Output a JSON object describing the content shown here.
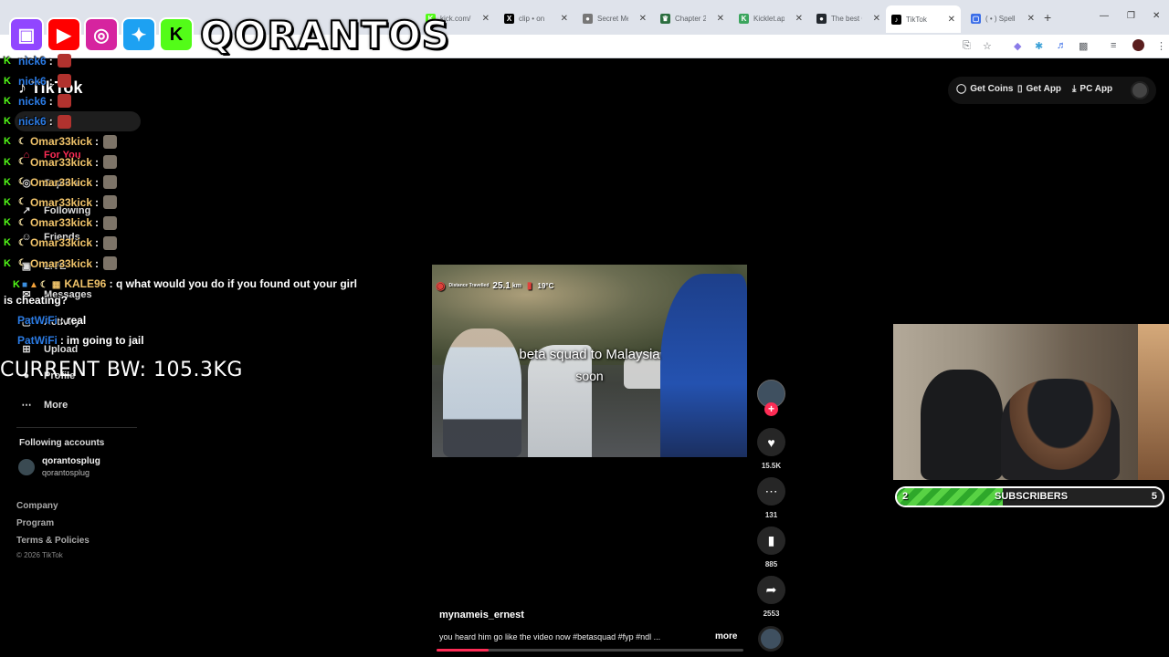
{
  "browser": {
    "tabs": [
      {
        "title": "kick.com/",
        "favicon": "kick-icon",
        "color": "#53fc18",
        "glyph": "K"
      },
      {
        "title": "clip • on",
        "favicon": "x-icon",
        "color": "#000000",
        "glyph": "X"
      },
      {
        "title": "Secret Me",
        "favicon": "gray-circle-icon",
        "color": "#777777",
        "glyph": "●"
      },
      {
        "title": "Chapter 2",
        "favicon": "crown-icon",
        "color": "#2c6e3f",
        "glyph": "♛"
      },
      {
        "title": "Kicklet.app",
        "favicon": "kicklet-icon",
        "color": "#3ba55d",
        "glyph": "K"
      },
      {
        "title": "The best C",
        "favicon": "github-icon",
        "color": "#24292f",
        "glyph": "●"
      },
      {
        "title": "TikTok",
        "favicon": "tiktok-icon",
        "color": "#000000",
        "glyph": "♪"
      },
      {
        "title": "( • ) Spell",
        "favicon": "spell-icon",
        "color": "#3b6ee8",
        "glyph": "▢"
      }
    ]
  },
  "overlay": {
    "brand": "QORANTOS",
    "socials": [
      {
        "name": "twitch-icon",
        "color": "#9146ff",
        "glyph": "▣"
      },
      {
        "name": "youtube-icon",
        "color": "#ff0000",
        "glyph": "▶"
      },
      {
        "name": "instagram-icon",
        "color": "#d6249f",
        "glyph": "◎"
      },
      {
        "name": "twitter-icon",
        "color": "#1da1f2",
        "glyph": "✦"
      },
      {
        "name": "kick-icon",
        "color": "#53fc18",
        "glyph": "K"
      }
    ],
    "bodyweight": "CURRENT BW: 105.3KG",
    "subscribers": {
      "label": "SUBSCRIBERS",
      "current": "2",
      "goal": "5",
      "progress": 0.4
    }
  },
  "chat": {
    "lines": [
      {
        "user": "nick6",
        "color": "#2b7be4",
        "badge": "K",
        "moon": false,
        "emote": "red"
      },
      {
        "user": "nick6",
        "color": "#2b7be4",
        "badge": "K",
        "moon": false,
        "emote": "red"
      },
      {
        "user": "nick6",
        "color": "#2b7be4",
        "badge": "K",
        "moon": false,
        "emote": "red"
      },
      {
        "user": "nick6",
        "color": "#2b7be4",
        "badge": "K",
        "moon": false,
        "emote": "red"
      },
      {
        "user": "Omar33kick",
        "color": "#f0c36a",
        "badge": "K",
        "moon": true,
        "emote": "gray"
      },
      {
        "user": "Omar33kick",
        "color": "#f0c36a",
        "badge": "K",
        "moon": true,
        "emote": "gray"
      },
      {
        "user": "Omar33kick",
        "color": "#f0c36a",
        "badge": "K",
        "moon": true,
        "emote": "gray"
      },
      {
        "user": "Omar33kick",
        "color": "#f0c36a",
        "badge": "K",
        "moon": true,
        "emote": "gray"
      },
      {
        "user": "Omar33kick",
        "color": "#f0c36a",
        "badge": "K",
        "moon": true,
        "emote": "gray"
      },
      {
        "user": "Omar33kick",
        "color": "#f0c36a",
        "badge": "K",
        "moon": true,
        "emote": "gray"
      },
      {
        "user": "Omar33kick",
        "color": "#f0c36a",
        "badge": "K",
        "moon": true,
        "emote": "gray"
      }
    ],
    "kale": {
      "user": "KALE96",
      "color": "#f0c36a",
      "message": "q what would you do if you found out your girl is cheating?"
    },
    "patwifi": [
      {
        "user": "PatWiFi",
        "color": "#2b7be4",
        "message": "real"
      },
      {
        "user": "PatWiFi",
        "color": "#2b7be4",
        "message": "im going to jail"
      }
    ]
  },
  "tiktok": {
    "logo": "TikTok",
    "header": {
      "coins": "Get Coins",
      "app": "Get App",
      "pc": "PC App"
    },
    "nav": [
      {
        "label": "For You",
        "icon": "home-icon",
        "glyph": "⌂"
      },
      {
        "label": "Explore",
        "icon": "compass-icon",
        "glyph": "◎"
      },
      {
        "label": "Following",
        "icon": "following-icon",
        "glyph": "↗"
      },
      {
        "label": "Friends",
        "icon": "friends-icon",
        "glyph": "☺"
      },
      {
        "label": "LIVE",
        "icon": "live-icon",
        "glyph": "▣"
      },
      {
        "label": "Messages",
        "icon": "messages-icon",
        "glyph": "✉"
      },
      {
        "label": "Activity",
        "icon": "activity-icon",
        "glyph": "▢"
      },
      {
        "label": "Upload",
        "icon": "upload-icon",
        "glyph": "⊞"
      },
      {
        "label": "Profile",
        "icon": "profile-icon",
        "glyph": "●"
      },
      {
        "label": "More",
        "icon": "more-icon",
        "glyph": "⋯"
      }
    ],
    "following_accounts_label": "Following accounts",
    "following_account": {
      "name": "qorantosplug",
      "handle": "qorantosplug"
    },
    "footer": [
      "Company",
      "Program",
      "Terms & Policies"
    ],
    "copyright": "© 2026 TikTok",
    "video": {
      "hud_label": "Distance Travelled",
      "distance": "25.1",
      "distance_unit": "km",
      "temp": "19°C",
      "caption_line1": "beta squad to Malaysia",
      "caption_line2": "soon",
      "progress": 0.17
    },
    "rail": {
      "likes": "15.5K",
      "comments": "131",
      "saves": "885",
      "shares": "2553"
    },
    "author": "mynameis_ernest",
    "description": "you heard him go like the video now #betasquad #fyp #ndl ...",
    "more": "more"
  }
}
